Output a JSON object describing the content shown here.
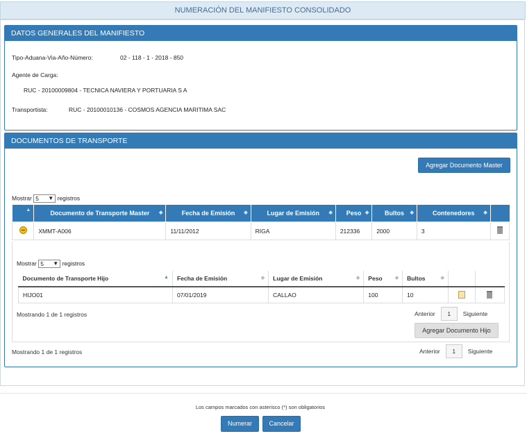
{
  "page_title": "NUMERACIÓN DEL MANIFIESTO CONSOLIDADO",
  "general": {
    "heading": "DATOS GENERALES DEL MANIFIESTO",
    "tipo_label": "Tipo-Aduana-Via-Año-Número:",
    "tipo_value": "02 - 118 - 1 - 2018 - 850",
    "agente_label": "Agente de Carga:",
    "agente_value": "RUC - 20100009804 - TECNICA NAVIERA Y PORTUARIA S A",
    "transportista_label": "Transportista:",
    "transportista_value": "RUC - 20100010136 - COSMOS AGENCIA MARITIMA SAC"
  },
  "docs": {
    "heading": "DOCUMENTOS DE TRANSPORTE",
    "add_master": "Agregar Documento Master",
    "show_label": "Mostrar",
    "show_value": "5",
    "records_label": "registros",
    "columns": [
      "Documento de Transporte Master",
      "Fecha de Emisión",
      "Lugar de Emisión",
      "Peso",
      "Bultos",
      "Contenedores"
    ],
    "row": [
      "XMMT-A006",
      "11/11/2012",
      "RIGA",
      "212336",
      "2000",
      "3"
    ],
    "summary": "Mostrando 1 de 1 registros",
    "prev": "Anterior",
    "page": "1",
    "next": "Siguiente"
  },
  "child": {
    "show_label": "Mostrar",
    "show_value": "5",
    "records_label": "registros",
    "columns": [
      "Documento de Transporte Hijo",
      "Fecha de Emisión",
      "Lugar de Emisión",
      "Peso",
      "Bultos"
    ],
    "row": [
      "HIJO01",
      "07/01/2019",
      "CALLAO",
      "100",
      "10"
    ],
    "summary": "Mostrando 1 de 1 registros",
    "prev": "Anterior",
    "page": "1",
    "next": "Siguiente",
    "add_child": "Agregar Documento Hijo"
  },
  "footer": {
    "note": "Los campos marcados con asterisco (*) son obligatorios",
    "numerar": "Numerar",
    "cancelar": "Cancelar"
  }
}
